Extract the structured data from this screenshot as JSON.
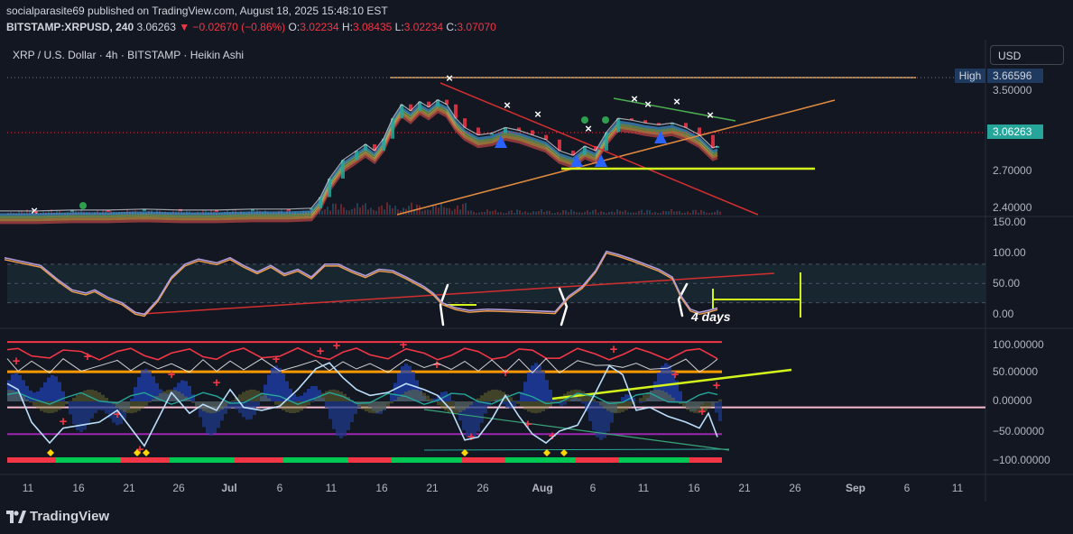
{
  "header": {
    "publisher_line": "socialparasite69 published on TradingView.com, August 18, 2025 15:48:10 EST",
    "symbol": "BITSTAMP:XRPUSD, 240",
    "last": "3.06263",
    "change": "▼ −0.02670 (−0.86%)",
    "o_label": "O:",
    "o": "3.02234",
    "h_label": "H:",
    "h": "3.08435",
    "l_label": "L:",
    "l": "3.02234",
    "c_label": "C:",
    "c": "3.07070"
  },
  "currency_button": "USD",
  "footer": {
    "brand": "TradingView"
  },
  "colors": {
    "background": "#131722",
    "up": "#26a69a",
    "down": "#f23645",
    "trendline_red": "#d32f2f",
    "trendline_orange": "#f0a050",
    "highlight_yellow": "#d4f51c",
    "rsi_line": "#b39ddb"
  },
  "chart_data": [
    {
      "type": "line",
      "title": "XRP / U.S. Dollar · 4h · BITSTAMP · Heikin Ashi",
      "x_ticks": [
        "11",
        "16",
        "21",
        "26",
        "Jul",
        "6",
        "11",
        "16",
        "21",
        "26",
        "Aug",
        "6",
        "11",
        "16",
        "21",
        "26",
        "Sep",
        "6",
        "11"
      ],
      "y_ticks": [
        "3.50000",
        "2.70000",
        "2.40000"
      ],
      "ylim": [
        2.36,
        3.82
      ],
      "series": [
        {
          "values": [
            [
              0,
              2.4
            ],
            [
              40,
              2.4
            ],
            [
              80,
              2.41
            ],
            [
              120,
              2.41
            ],
            [
              160,
              2.42
            ],
            [
              200,
              2.41
            ],
            [
              240,
              2.41
            ],
            [
              280,
              2.42
            ],
            [
              320,
              2.42
            ],
            [
              345,
              2.43
            ],
            [
              355,
              2.55
            ],
            [
              365,
              2.75
            ],
            [
              380,
              2.95
            ],
            [
              395,
              3.05
            ],
            [
              405,
              3.12
            ],
            [
              415,
              3.05
            ],
            [
              425,
              3.18
            ],
            [
              435,
              3.4
            ],
            [
              445,
              3.55
            ],
            [
              455,
              3.48
            ],
            [
              465,
              3.58
            ],
            [
              475,
              3.52
            ],
            [
              485,
              3.6
            ],
            [
              495,
              3.55
            ],
            [
              505,
              3.4
            ],
            [
              515,
              3.3
            ],
            [
              530,
              3.22
            ],
            [
              545,
              3.24
            ],
            [
              560,
              3.3
            ],
            [
              575,
              3.27
            ],
            [
              590,
              3.22
            ],
            [
              605,
              3.17
            ],
            [
              620,
              3.05
            ],
            [
              635,
              3.0
            ],
            [
              648,
              3.1
            ],
            [
              660,
              3.05
            ],
            [
              672,
              3.25
            ],
            [
              685,
              3.4
            ],
            [
              700,
              3.38
            ],
            [
              715,
              3.35
            ],
            [
              730,
              3.33
            ],
            [
              745,
              3.35
            ],
            [
              760,
              3.3
            ],
            [
              775,
              3.22
            ],
            [
              790,
              3.08
            ],
            [
              795,
              3.1
            ]
          ]
        }
      ],
      "annotations": {
        "high_label": "High",
        "high_value": "3.66596",
        "last_price": "3.06263"
      }
    },
    {
      "type": "line",
      "y_ticks": [
        "150.00",
        "100.00",
        "50.00",
        "0.00"
      ],
      "ylim": [
        -17,
        150
      ],
      "annotations": {
        "text": "4 days"
      },
      "series": [
        {
          "values": [
            [
              5,
              90
            ],
            [
              25,
              84
            ],
            [
              45,
              78
            ],
            [
              65,
              55
            ],
            [
              80,
              40
            ],
            [
              95,
              35
            ],
            [
              105,
              40
            ],
            [
              120,
              28
            ],
            [
              135,
              20
            ],
            [
              150,
              5
            ],
            [
              160,
              2
            ],
            [
              175,
              25
            ],
            [
              190,
              60
            ],
            [
              205,
              80
            ],
            [
              220,
              88
            ],
            [
              240,
              82
            ],
            [
              255,
              90
            ],
            [
              270,
              78
            ],
            [
              285,
              68
            ],
            [
              300,
              78
            ],
            [
              315,
              65
            ],
            [
              330,
              72
            ],
            [
              345,
              60
            ],
            [
              360,
              80
            ],
            [
              375,
              80
            ],
            [
              390,
              70
            ],
            [
              405,
              62
            ],
            [
              420,
              72
            ],
            [
              435,
              70
            ],
            [
              450,
              60
            ],
            [
              470,
              45
            ],
            [
              480,
              35
            ],
            [
              490,
              20
            ],
            [
              505,
              12
            ],
            [
              520,
              8
            ],
            [
              540,
              10
            ],
            [
              560,
              9
            ],
            [
              580,
              8
            ],
            [
              600,
              7
            ],
            [
              615,
              6
            ],
            [
              630,
              30
            ],
            [
              645,
              45
            ],
            [
              660,
              70
            ],
            [
              672,
              100
            ],
            [
              685,
              95
            ],
            [
              700,
              88
            ],
            [
              715,
              80
            ],
            [
              730,
              72
            ],
            [
              745,
              60
            ],
            [
              755,
              30
            ],
            [
              765,
              10
            ],
            [
              775,
              5
            ],
            [
              785,
              8
            ],
            [
              795,
              12
            ]
          ]
        }
      ]
    },
    {
      "type": "line",
      "y_ticks": [
        "100.00000",
        "50.00000",
        "0.00000",
        "−50.00000",
        "−100.00000"
      ],
      "ylim": [
        -120,
        120
      ],
      "series": [
        {
          "values": [
            [
              8,
              30
            ],
            [
              20,
              20
            ],
            [
              35,
              -35
            ],
            [
              55,
              -70
            ],
            [
              70,
              -45
            ],
            [
              90,
              -40
            ],
            [
              110,
              -35
            ],
            [
              130,
              -15
            ],
            [
              145,
              -45
            ],
            [
              160,
              -75
            ],
            [
              175,
              -30
            ],
            [
              190,
              15
            ],
            [
              210,
              -20
            ],
            [
              225,
              -5
            ],
            [
              240,
              -15
            ],
            [
              255,
              20
            ],
            [
              270,
              -10
            ],
            [
              290,
              -15
            ],
            [
              310,
              -8
            ],
            [
              330,
              20
            ],
            [
              350,
              55
            ],
            [
              365,
              65
            ],
            [
              380,
              40
            ],
            [
              395,
              20
            ],
            [
              410,
              10
            ],
            [
              430,
              15
            ],
            [
              450,
              30
            ],
            [
              470,
              20
            ],
            [
              485,
              10
            ],
            [
              500,
              -15
            ],
            [
              515,
              -65
            ],
            [
              530,
              -60
            ],
            [
              545,
              -30
            ],
            [
              560,
              10
            ],
            [
              575,
              -25
            ],
            [
              590,
              -55
            ],
            [
              605,
              -70
            ],
            [
              620,
              -50
            ],
            [
              640,
              -40
            ],
            [
              660,
              15
            ],
            [
              675,
              60
            ],
            [
              690,
              45
            ],
            [
              705,
              -15
            ],
            [
              720,
              -10
            ],
            [
              740,
              -25
            ],
            [
              760,
              -35
            ],
            [
              775,
              -45
            ],
            [
              785,
              -20
            ],
            [
              795,
              -60
            ]
          ]
        }
      ]
    }
  ]
}
